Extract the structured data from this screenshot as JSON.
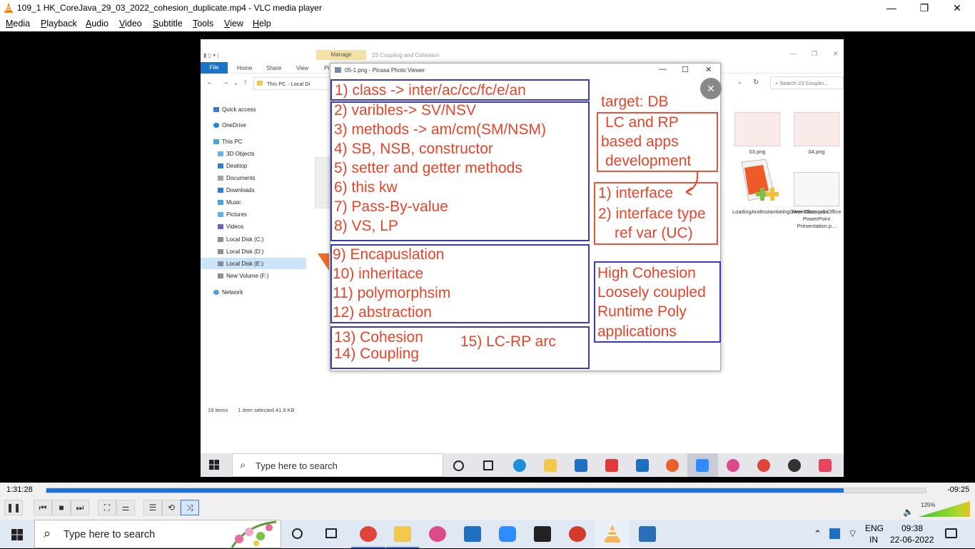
{
  "window": {
    "title": "109_1 HK_CoreJava_29_03_2022_cohesion_duplicate.mp4 - VLC media player",
    "minimize": "—",
    "maximize": "❐",
    "close": "✕"
  },
  "menu": [
    "Media",
    "Playback",
    "Audio",
    "Video",
    "Subtitle",
    "Tools",
    "View",
    "Help"
  ],
  "explorer": {
    "manage_tab": "Manage",
    "window_title": "23 Coupling and Cohesion",
    "ribbon_tabs": [
      "File",
      "Home",
      "Share",
      "View",
      "Pi"
    ],
    "address": [
      "This PC",
      "Local Di"
    ],
    "search_placeholder": "Search 23 Couplin...",
    "nav": [
      "Quick access",
      "OneDrive",
      "This PC",
      "3D Objects",
      "Desktop",
      "Documents",
      "Downloads",
      "Music",
      "Pictures",
      "Videos",
      "Local Disk (C:)",
      "Local Disk (D:)",
      "Local Disk (E:)",
      "New Volume (F:)",
      "Network"
    ],
    "status_items": "19 items",
    "status_selected": "1 item selected  41.9 KB",
    "files": [
      {
        "label": "03.png"
      },
      {
        "label": "04.png"
      },
      {
        "label": "LoadingAndInstantiatingGivenClass.java"
      },
      {
        "label": "New Microsoft Office PowerPoint Presentation.p..."
      }
    ]
  },
  "picasa": {
    "title": "05-1.png - Picasa Photo Viewer",
    "close_badge": "✕",
    "left_notes": [
      "1) class -> inter/ac/cc/fc/e/an",
      "2) varibles-> SV/NSV",
      "3) methods -> am/cm(SM/NSM)",
      "4) SB, NSB, constructor",
      "5) setter and getter methods",
      "6) this kw",
      "7) Pass-By-value",
      "8) VS, LP",
      "9) Encapuslation",
      "10) inheritace",
      "11) polymorphsim",
      "12) abstraction",
      "13) Cohesion",
      "14) Coupling",
      "15) LC-RP arc"
    ],
    "right_notes": [
      "target:  DB",
      "LC and RP",
      "based apps",
      "development",
      "1) interface",
      "2) interface type",
      "ref var (UC)",
      "High Cohesion",
      "Loosely coupled",
      "Runtime Poly",
      "applications"
    ]
  },
  "inner_taskbar": {
    "search_placeholder": "Type here to search"
  },
  "player": {
    "elapsed": "1:31:28",
    "remaining": "-09:25",
    "progress": 0.907,
    "volume": "125%"
  },
  "taskbar": {
    "search_placeholder": "Type here to search",
    "lang_top": "ENG",
    "lang_bottom": "IN",
    "time": "09:38",
    "date": "22-06-2022"
  },
  "colors": {
    "note_red": "#e8442a",
    "box_blue": "#3b3bb0",
    "seek_blue": "#1e72d6"
  }
}
